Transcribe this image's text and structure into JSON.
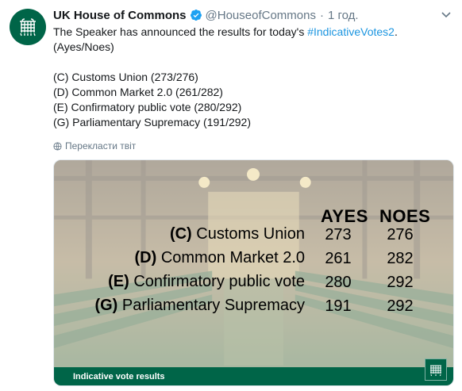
{
  "tweet": {
    "author_name": "UK House of Commons",
    "handle": "@HouseofCommons",
    "separator": "·",
    "time": "1 год.",
    "line1_text": "The Speaker has announced the results for today's ",
    "hashtag": "#IndicativeVotes2",
    "line1_end": ".",
    "line2": "(Ayes/Noes)",
    "results": [
      "(C) Customs Union (273/276)",
      "(D) Common Market 2.0 (261/282)",
      "(E) Confirmatory public vote (280/292)",
      "(G) Parliamentary Supremacy (191/292)"
    ],
    "translate_label": "Перекласти твіт"
  },
  "media": {
    "col_ayes": "AYES",
    "col_noes": "NOES",
    "rows": [
      {
        "code": "(C)",
        "name": "Customs Union",
        "ayes": "273",
        "noes": "276"
      },
      {
        "code": "(D)",
        "name": "Common Market 2.0",
        "ayes": "261",
        "noes": "282"
      },
      {
        "code": "(E)",
        "name": "Confirmatory public vote",
        "ayes": "280",
        "noes": "292"
      },
      {
        "code": "(G)",
        "name": "Parliamentary Supremacy",
        "ayes": "191",
        "noes": "292"
      }
    ],
    "footer": "Indicative vote results"
  },
  "colors": {
    "brand_green": "#006548",
    "link_blue": "#1b95e0",
    "muted": "#657786"
  },
  "icons": {
    "avatar": "portcullis-icon",
    "verified": "verified-badge-icon",
    "menu": "chevron-down-icon",
    "translate": "globe-icon",
    "badge": "portcullis-icon"
  }
}
